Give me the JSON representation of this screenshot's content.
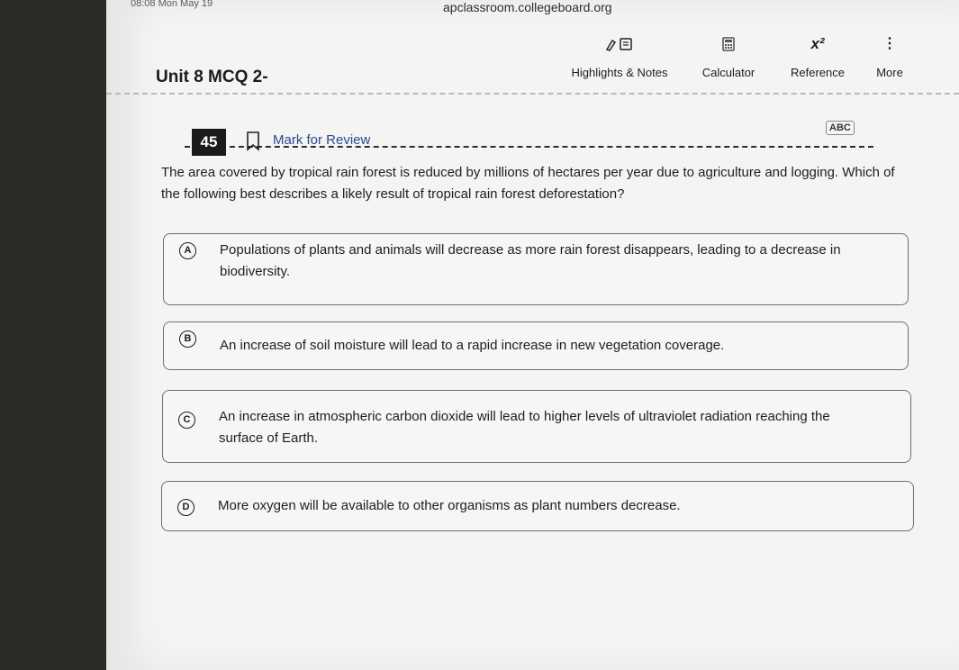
{
  "status_bar": {
    "time": "08:08  Mon May 19"
  },
  "browser": {
    "url": "apclassroom.collegeboard.org"
  },
  "header": {
    "test_title": "Unit 8 MCQ 2-",
    "tools": {
      "highlights": "Highlights & Notes",
      "calculator": "Calculator",
      "reference": "Reference",
      "more": "More"
    }
  },
  "question": {
    "number": "45",
    "mark_for_review": "Mark for Review",
    "abc_label": "ABC",
    "stem": "The area covered by tropical rain forest is reduced by millions of hectares per year due to agriculture and logging. Which of the following best describes a likely result of tropical rain forest deforestation?",
    "options": [
      {
        "letter": "A",
        "text": "Populations of plants and animals will decrease as more rain forest disappears, leading to a decrease in biodiversity."
      },
      {
        "letter": "B",
        "text": "An increase of soil moisture will lead to a rapid increase in new vegetation coverage."
      },
      {
        "letter": "C",
        "text": "An increase in atmospheric carbon dioxide will lead to higher levels of ultraviolet radiation reaching the surface of Earth."
      },
      {
        "letter": "D",
        "text": "More oxygen will be available to other organisms as plant numbers decrease."
      }
    ]
  }
}
